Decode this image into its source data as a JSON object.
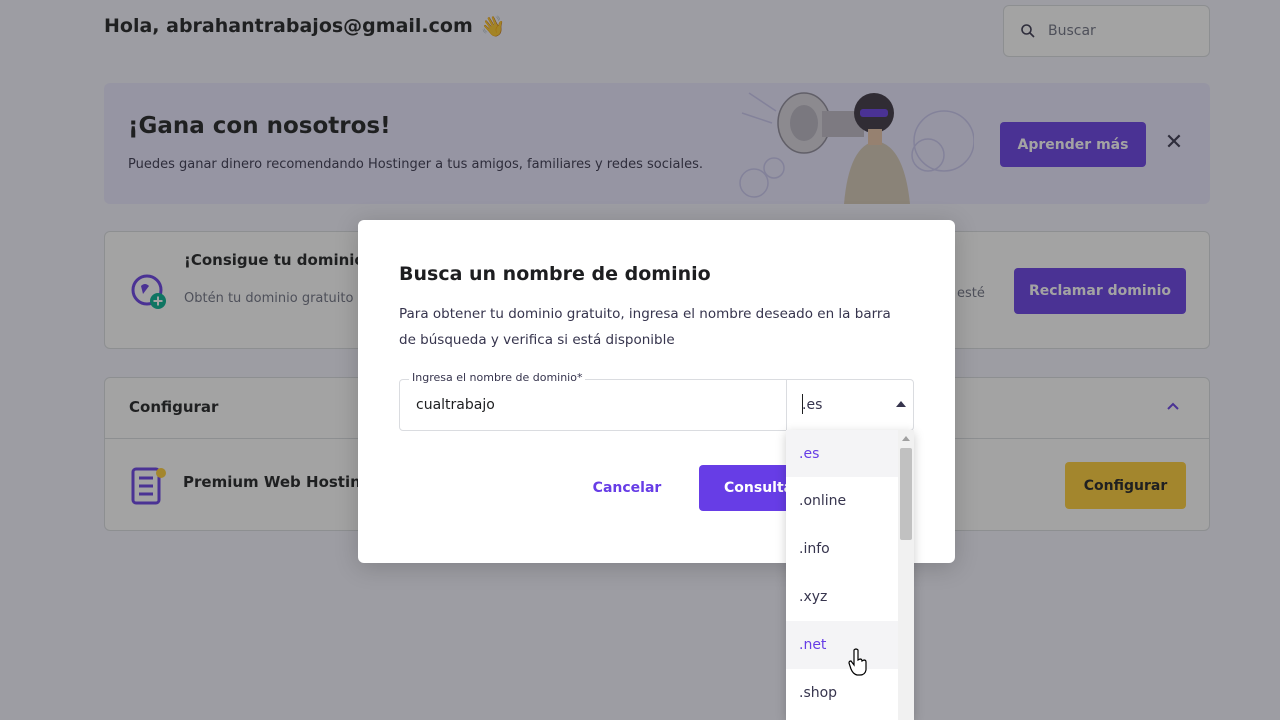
{
  "header": {
    "greeting": "Hola, abrahantrabajos@gmail.com",
    "search_placeholder": "Buscar"
  },
  "promo": {
    "title": "¡Gana con nosotros!",
    "text": "Puedes ganar dinero recomendando Hostinger a tus amigos, familiares y redes sociales.",
    "button": "Aprender más"
  },
  "domain_card": {
    "title": "¡Consigue tu dominio g",
    "text": "Obtén tu dominio gratuito e activa.",
    "text_right": "esté",
    "button": "Reclamar dominio"
  },
  "config_card": {
    "title": "Configurar",
    "item_title": "Premium Web Hosting",
    "button": "Configurar"
  },
  "modal": {
    "title": "Busca un nombre de dominio",
    "description": "Para obtener tu dominio gratuito, ingresa el nombre deseado en la barra de búsqueda y verifica si está disponible",
    "field_label": "Ingresa el nombre de dominio*",
    "field_value": "cualtrabajo",
    "tld_selected": ".es",
    "cancel": "Cancelar",
    "consult": "Consulta"
  },
  "dropdown": {
    "options": [
      ".es",
      ".online",
      ".info",
      ".xyz",
      ".net",
      ".shop"
    ],
    "selected_index": 0,
    "hover_index": 4
  },
  "colors": {
    "primary": "#673de6",
    "accent_yellow": "#ffcd35",
    "promo_bg": "#e9e7ff"
  }
}
